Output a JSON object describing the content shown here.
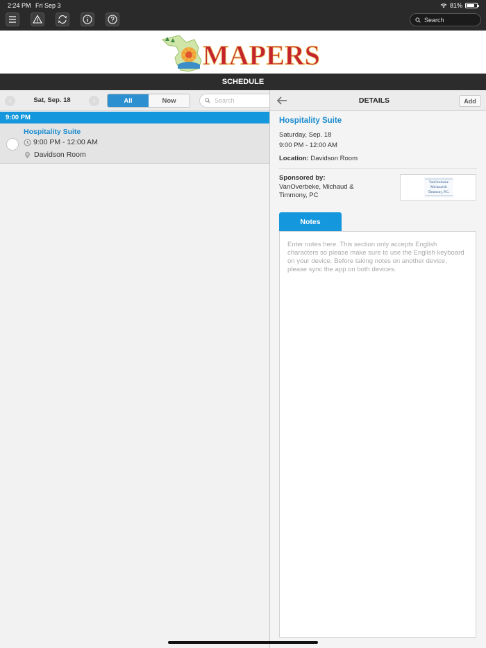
{
  "status_bar": {
    "time": "2:24 PM",
    "date": "Fri Sep 3",
    "battery": "81%",
    "battery_level": 0.81
  },
  "toolbar": {
    "buttons": [
      {
        "icon": "menu-icon"
      },
      {
        "icon": "alert-icon"
      },
      {
        "icon": "sync-icon"
      },
      {
        "icon": "info-icon"
      },
      {
        "icon": "help-icon"
      }
    ],
    "search_placeholder": "Search"
  },
  "banner": {
    "logo_text": "MAPERS"
  },
  "schedule": {
    "title": "SCHEDULE",
    "date": "Sat, Sep. 18",
    "filters": [
      "All",
      "Now"
    ],
    "active_filter": "All",
    "search_placeholder": "Search",
    "time_header": "9:00 PM",
    "sessions": [
      {
        "title": "Hospitality Suite",
        "time": "9:00 PM - 12:00 AM",
        "location": "Davidson Room"
      }
    ]
  },
  "details": {
    "title": "DETAILS",
    "add_label": "Add",
    "session_title": "Hospitality Suite",
    "date": "Saturday, Sep. 18",
    "time": "9:00 PM - 12:00 AM",
    "location_label": "Location:",
    "location": "Davidson Room",
    "sponsored_label": "Sponsored by:",
    "sponsor": "VanOverbeke, Michaud & Timmony, PC",
    "sponsor_logo_text": "VanOverbeke Michaud & Timmony, P.C.",
    "notes_tab": "Notes",
    "notes_placeholder": "Enter notes here. This section only accepts English characters so please make sure to use the English keyboard on your device. Before taking notes on another device, please sync the app on both devices."
  },
  "colors": {
    "accent": "#1497dc",
    "link": "#1b8ccf",
    "dark_bar": "#2a2a2a",
    "logo_red": "#c4242c"
  }
}
